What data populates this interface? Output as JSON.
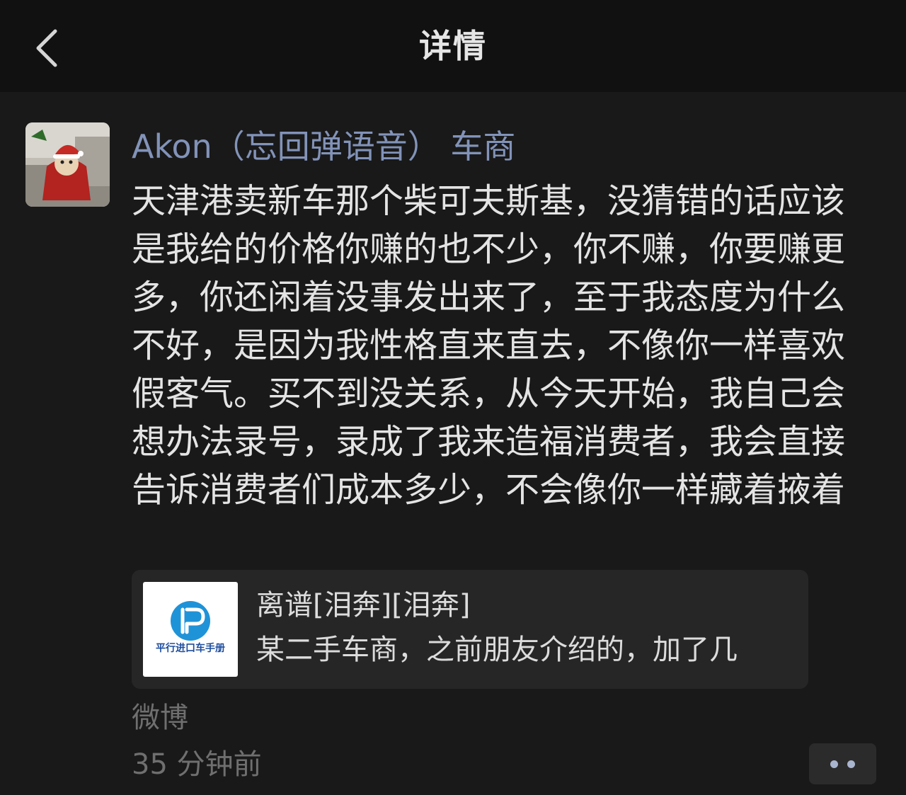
{
  "header": {
    "title": "详情",
    "back_icon": "chevron-left-icon"
  },
  "post": {
    "author": "Akon（忘回弹语音） 车商",
    "text": "天津港卖新车那个柴可夫斯基，没猜错的话应该是我给的价格你赚的也不少，你不赚，你要赚更多，你还闲着没事发出来了，至于我态度为什么不好，是因为我性格直来直去，不像你一样喜欢假客气。买不到没关系，从今天开始，我自己会想办法录号，录成了我来造福消费者，我会直接告诉消费者们成本多少，不会像你一样藏着掖着",
    "link_card": {
      "thumb_brand": "平行进口车手册",
      "title": "离谱[泪奔][泪奔]",
      "description": "某二手车商，之前朋友介绍的，加了几"
    },
    "source": "微博",
    "timestamp": "35 分钟前",
    "more_icon": "more-dots-icon"
  },
  "colors": {
    "background": "#191919",
    "header_bg": "#111111",
    "author_name": "#8293b9",
    "card_bg": "#262626",
    "meta_text": "#6f6f6f",
    "brand_blue": "#1e4d9e"
  }
}
